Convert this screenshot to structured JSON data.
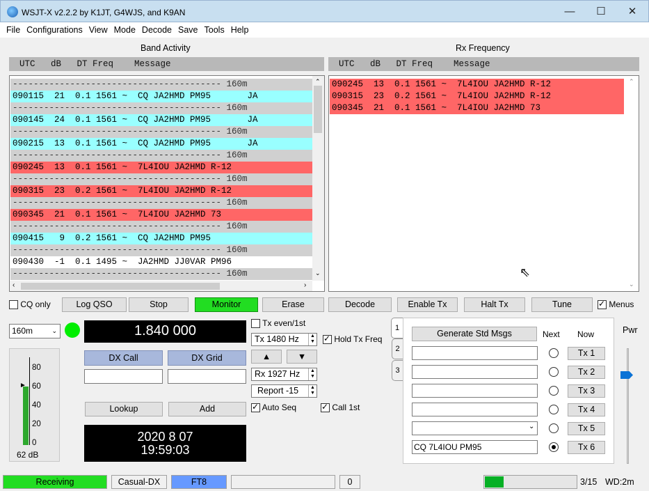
{
  "window": {
    "title": "WSJT-X   v2.2.2   by K1JT, G4WJS, and K9AN",
    "minimize": "—",
    "maximize": "☐",
    "close": "✕"
  },
  "menu": [
    "File",
    "Configurations",
    "View",
    "Mode",
    "Decode",
    "Save",
    "Tools",
    "Help"
  ],
  "band_activity": {
    "label": "Band Activity",
    "header": "  UTC   dB   DT Freq    Message",
    "rows": [
      {
        "text": "---------------------------------------- 160m",
        "type": "sep"
      },
      {
        "text": "090115  21  0.1 1561 ~  CQ JA2HMD PM95       JA",
        "type": "cq"
      },
      {
        "text": "---------------------------------------- 160m",
        "type": "sep"
      },
      {
        "text": "090145  24  0.1 1561 ~  CQ JA2HMD PM95       JA",
        "type": "cq"
      },
      {
        "text": "---------------------------------------- 160m",
        "type": "sep"
      },
      {
        "text": "090215  13  0.1 1561 ~  CQ JA2HMD PM95       JA",
        "type": "cq"
      },
      {
        "text": "---------------------------------------- 160m",
        "type": "sep"
      },
      {
        "text": "090245  13  0.1 1561 ~  7L4IOU JA2HMD R-12",
        "type": "mine"
      },
      {
        "text": "---------------------------------------- 160m",
        "type": "sep"
      },
      {
        "text": "090315  23  0.2 1561 ~  7L4IOU JA2HMD R-12",
        "type": "mine"
      },
      {
        "text": "---------------------------------------- 160m",
        "type": "sep"
      },
      {
        "text": "090345  21  0.1 1561 ~  7L4IOU JA2HMD 73",
        "type": "mine"
      },
      {
        "text": "---------------------------------------- 160m",
        "type": "sep"
      },
      {
        "text": "090415   9  0.2 1561 ~  CQ JA2HMD PM95",
        "type": "cq"
      },
      {
        "text": "---------------------------------------- 160m",
        "type": "sep"
      },
      {
        "text": "090430  -1  0.1 1495 ~  JA2HMD JJ0VAR PM96",
        "type": "plain"
      },
      {
        "text": "---------------------------------------- 160m",
        "type": "sep"
      }
    ]
  },
  "rx_frequency": {
    "label": "Rx Frequency",
    "header": "  UTC   dB   DT Freq    Message",
    "rows": [
      "090245  13  0.1 1561 ~  7L4IOU JA2HMD R-12",
      "090315  23  0.2 1561 ~  7L4IOU JA2HMD R-12",
      "090345  21  0.1 1561 ~  7L4IOU JA2HMD 73"
    ]
  },
  "controls": {
    "cq_only": "CQ only",
    "log_qso": "Log QSO",
    "stop": "Stop",
    "monitor": "Monitor",
    "erase": "Erase",
    "decode": "Decode",
    "enable_tx": "Enable Tx",
    "halt_tx": "Halt Tx",
    "tune": "Tune",
    "menus": "Menus"
  },
  "band_select": "160m",
  "frequency_display": "1.840 000",
  "tx_even": "Tx even/1st",
  "tx_freq": "Tx  1480  Hz",
  "rx_freq": "Rx  1927  Hz",
  "hold_tx_freq": "Hold Tx Freq",
  "report": "Report  -15",
  "auto_seq": "Auto Seq",
  "call_1st": "Call 1st",
  "dx_call_label": "DX Call",
  "dx_grid_label": "DX Grid",
  "dx_call_value": "",
  "dx_grid_value": "",
  "lookup": "Lookup",
  "add": "Add",
  "datetime": {
    "date": "2020 8 07",
    "time": "19:59:03"
  },
  "meter": {
    "ticks": [
      "80",
      "60",
      "40",
      "20",
      "0"
    ],
    "level_db": "62 dB",
    "level_fraction": 0.62
  },
  "tabs": [
    "1",
    "2",
    "3"
  ],
  "generate_std_msgs": "Generate Std Msgs",
  "next_label": "Next",
  "now_label": "Now",
  "tx_messages": [
    {
      "value": "",
      "button": "Tx 1"
    },
    {
      "value": "",
      "button": "Tx 2"
    },
    {
      "value": "",
      "button": "Tx 3"
    },
    {
      "value": "",
      "button": "Tx 4"
    },
    {
      "value": "",
      "button": "Tx 5"
    },
    {
      "value": "CQ 7L4IOU PM95",
      "button": "Tx 6"
    }
  ],
  "pwr_label": "Pwr",
  "status_bar": {
    "receiving": "Receiving",
    "mode_config": "Casual-DX",
    "mode": "FT8",
    "tx_count": "0",
    "progress": "3/15",
    "wd": "WD:2m",
    "progress_fraction": 0.2
  },
  "colors": {
    "cq": "#99ffff",
    "mine": "#ff6666",
    "monitor": "#00ff00",
    "ft8": "#6699ff"
  }
}
